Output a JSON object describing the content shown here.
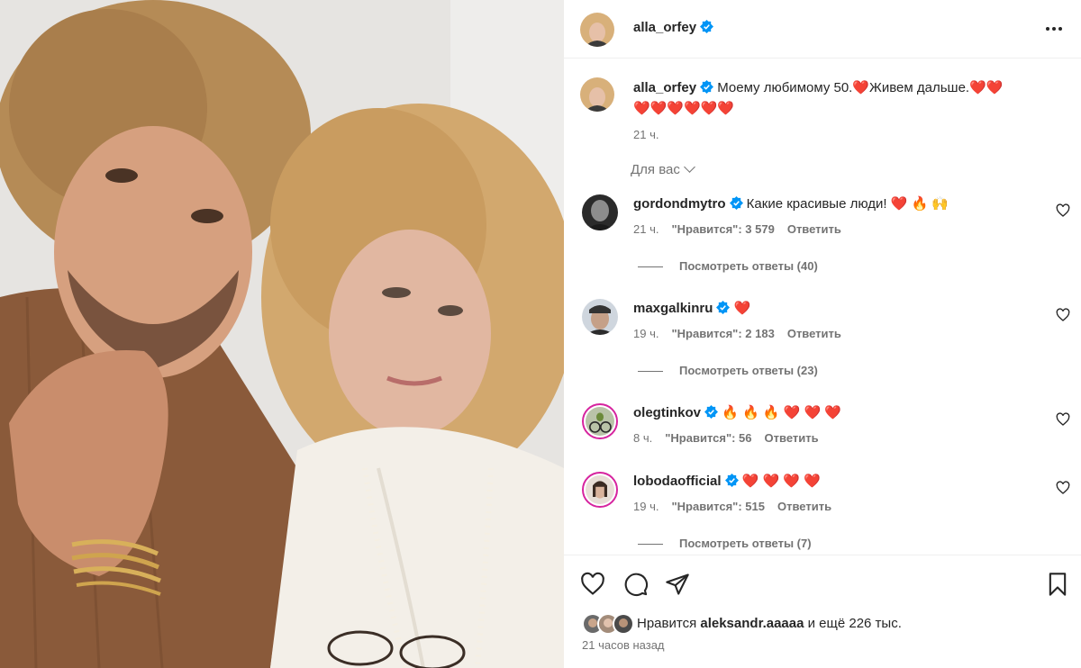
{
  "post": {
    "author": "alla_orfey",
    "more_icon": "more-horizontal-icon"
  },
  "caption": {
    "username": "alla_orfey",
    "text_part1": "Моему любимому 50.",
    "text_part2": "Живем дальше.",
    "time": "21 ч."
  },
  "for_you_label": "Для вас",
  "comments": [
    {
      "username": "gordondmytro",
      "text": "Какие красивые люди! ",
      "emoji": "❤️ 🔥 🙌",
      "time": "21 ч.",
      "likes": "\"Нравится\": 3 579",
      "reply": "Ответить",
      "view_replies": "Посмотреть ответы (40)"
    },
    {
      "username": "maxgalkinru",
      "text": "",
      "emoji": "❤️",
      "time": "19 ч.",
      "likes": "\"Нравится\": 2 183",
      "reply": "Ответить",
      "view_replies": "Посмотреть ответы (23)"
    },
    {
      "username": "olegtinkov",
      "text": "",
      "emoji": "🔥 🔥 🔥 ❤️ ❤️ ❤️",
      "time": "8 ч.",
      "likes": "\"Нравится\": 56",
      "reply": "Ответить",
      "view_replies": ""
    },
    {
      "username": "lobodaofficial",
      "text": "",
      "emoji": "❤️ ❤️ ❤️ ❤️",
      "time": "19 ч.",
      "likes": "\"Нравится\": 515",
      "reply": "Ответить",
      "view_replies": "Посмотреть ответы (7)"
    }
  ],
  "liked_by": {
    "prefix": "Нравится ",
    "user": "aleksandr.aaaaa",
    "suffix": " и ещё 226 тыс."
  },
  "time_ago": "21 часов назад",
  "colors": {
    "heart": "#e0245e",
    "verified": "#0095f6",
    "secondary_text": "#737373"
  }
}
